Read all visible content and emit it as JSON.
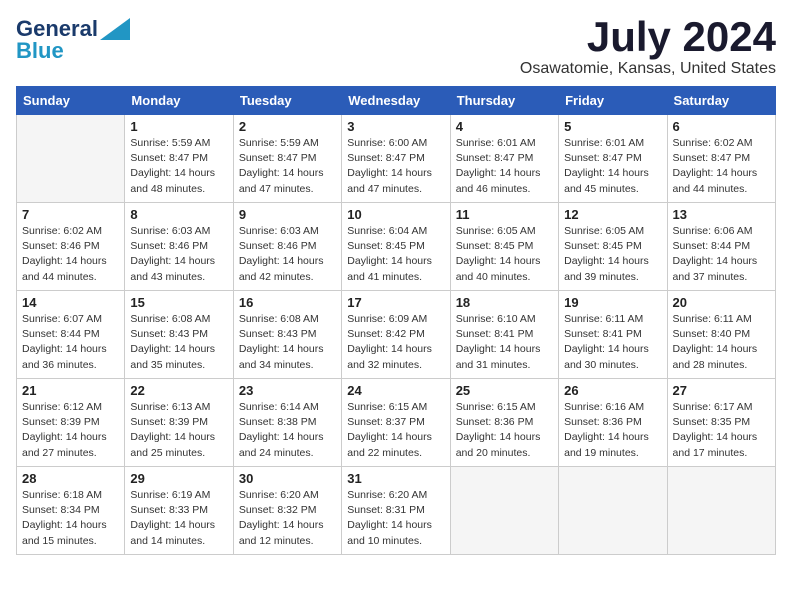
{
  "header": {
    "logo_general": "General",
    "logo_blue": "Blue",
    "month_title": "July 2024",
    "location": "Osawatomie, Kansas, United States"
  },
  "weekdays": [
    "Sunday",
    "Monday",
    "Tuesday",
    "Wednesday",
    "Thursday",
    "Friday",
    "Saturday"
  ],
  "weeks": [
    [
      {
        "day": "",
        "sunrise": "",
        "sunset": "",
        "daylight": ""
      },
      {
        "day": "1",
        "sunrise": "Sunrise: 5:59 AM",
        "sunset": "Sunset: 8:47 PM",
        "daylight": "Daylight: 14 hours and 48 minutes."
      },
      {
        "day": "2",
        "sunrise": "Sunrise: 5:59 AM",
        "sunset": "Sunset: 8:47 PM",
        "daylight": "Daylight: 14 hours and 47 minutes."
      },
      {
        "day": "3",
        "sunrise": "Sunrise: 6:00 AM",
        "sunset": "Sunset: 8:47 PM",
        "daylight": "Daylight: 14 hours and 47 minutes."
      },
      {
        "day": "4",
        "sunrise": "Sunrise: 6:01 AM",
        "sunset": "Sunset: 8:47 PM",
        "daylight": "Daylight: 14 hours and 46 minutes."
      },
      {
        "day": "5",
        "sunrise": "Sunrise: 6:01 AM",
        "sunset": "Sunset: 8:47 PM",
        "daylight": "Daylight: 14 hours and 45 minutes."
      },
      {
        "day": "6",
        "sunrise": "Sunrise: 6:02 AM",
        "sunset": "Sunset: 8:47 PM",
        "daylight": "Daylight: 14 hours and 44 minutes."
      }
    ],
    [
      {
        "day": "7",
        "sunrise": "Sunrise: 6:02 AM",
        "sunset": "Sunset: 8:46 PM",
        "daylight": "Daylight: 14 hours and 44 minutes."
      },
      {
        "day": "8",
        "sunrise": "Sunrise: 6:03 AM",
        "sunset": "Sunset: 8:46 PM",
        "daylight": "Daylight: 14 hours and 43 minutes."
      },
      {
        "day": "9",
        "sunrise": "Sunrise: 6:03 AM",
        "sunset": "Sunset: 8:46 PM",
        "daylight": "Daylight: 14 hours and 42 minutes."
      },
      {
        "day": "10",
        "sunrise": "Sunrise: 6:04 AM",
        "sunset": "Sunset: 8:45 PM",
        "daylight": "Daylight: 14 hours and 41 minutes."
      },
      {
        "day": "11",
        "sunrise": "Sunrise: 6:05 AM",
        "sunset": "Sunset: 8:45 PM",
        "daylight": "Daylight: 14 hours and 40 minutes."
      },
      {
        "day": "12",
        "sunrise": "Sunrise: 6:05 AM",
        "sunset": "Sunset: 8:45 PM",
        "daylight": "Daylight: 14 hours and 39 minutes."
      },
      {
        "day": "13",
        "sunrise": "Sunrise: 6:06 AM",
        "sunset": "Sunset: 8:44 PM",
        "daylight": "Daylight: 14 hours and 37 minutes."
      }
    ],
    [
      {
        "day": "14",
        "sunrise": "Sunrise: 6:07 AM",
        "sunset": "Sunset: 8:44 PM",
        "daylight": "Daylight: 14 hours and 36 minutes."
      },
      {
        "day": "15",
        "sunrise": "Sunrise: 6:08 AM",
        "sunset": "Sunset: 8:43 PM",
        "daylight": "Daylight: 14 hours and 35 minutes."
      },
      {
        "day": "16",
        "sunrise": "Sunrise: 6:08 AM",
        "sunset": "Sunset: 8:43 PM",
        "daylight": "Daylight: 14 hours and 34 minutes."
      },
      {
        "day": "17",
        "sunrise": "Sunrise: 6:09 AM",
        "sunset": "Sunset: 8:42 PM",
        "daylight": "Daylight: 14 hours and 32 minutes."
      },
      {
        "day": "18",
        "sunrise": "Sunrise: 6:10 AM",
        "sunset": "Sunset: 8:41 PM",
        "daylight": "Daylight: 14 hours and 31 minutes."
      },
      {
        "day": "19",
        "sunrise": "Sunrise: 6:11 AM",
        "sunset": "Sunset: 8:41 PM",
        "daylight": "Daylight: 14 hours and 30 minutes."
      },
      {
        "day": "20",
        "sunrise": "Sunrise: 6:11 AM",
        "sunset": "Sunset: 8:40 PM",
        "daylight": "Daylight: 14 hours and 28 minutes."
      }
    ],
    [
      {
        "day": "21",
        "sunrise": "Sunrise: 6:12 AM",
        "sunset": "Sunset: 8:39 PM",
        "daylight": "Daylight: 14 hours and 27 minutes."
      },
      {
        "day": "22",
        "sunrise": "Sunrise: 6:13 AM",
        "sunset": "Sunset: 8:39 PM",
        "daylight": "Daylight: 14 hours and 25 minutes."
      },
      {
        "day": "23",
        "sunrise": "Sunrise: 6:14 AM",
        "sunset": "Sunset: 8:38 PM",
        "daylight": "Daylight: 14 hours and 24 minutes."
      },
      {
        "day": "24",
        "sunrise": "Sunrise: 6:15 AM",
        "sunset": "Sunset: 8:37 PM",
        "daylight": "Daylight: 14 hours and 22 minutes."
      },
      {
        "day": "25",
        "sunrise": "Sunrise: 6:15 AM",
        "sunset": "Sunset: 8:36 PM",
        "daylight": "Daylight: 14 hours and 20 minutes."
      },
      {
        "day": "26",
        "sunrise": "Sunrise: 6:16 AM",
        "sunset": "Sunset: 8:36 PM",
        "daylight": "Daylight: 14 hours and 19 minutes."
      },
      {
        "day": "27",
        "sunrise": "Sunrise: 6:17 AM",
        "sunset": "Sunset: 8:35 PM",
        "daylight": "Daylight: 14 hours and 17 minutes."
      }
    ],
    [
      {
        "day": "28",
        "sunrise": "Sunrise: 6:18 AM",
        "sunset": "Sunset: 8:34 PM",
        "daylight": "Daylight: 14 hours and 15 minutes."
      },
      {
        "day": "29",
        "sunrise": "Sunrise: 6:19 AM",
        "sunset": "Sunset: 8:33 PM",
        "daylight": "Daylight: 14 hours and 14 minutes."
      },
      {
        "day": "30",
        "sunrise": "Sunrise: 6:20 AM",
        "sunset": "Sunset: 8:32 PM",
        "daylight": "Daylight: 14 hours and 12 minutes."
      },
      {
        "day": "31",
        "sunrise": "Sunrise: 6:20 AM",
        "sunset": "Sunset: 8:31 PM",
        "daylight": "Daylight: 14 hours and 10 minutes."
      },
      {
        "day": "",
        "sunrise": "",
        "sunset": "",
        "daylight": ""
      },
      {
        "day": "",
        "sunrise": "",
        "sunset": "",
        "daylight": ""
      },
      {
        "day": "",
        "sunrise": "",
        "sunset": "",
        "daylight": ""
      }
    ]
  ]
}
